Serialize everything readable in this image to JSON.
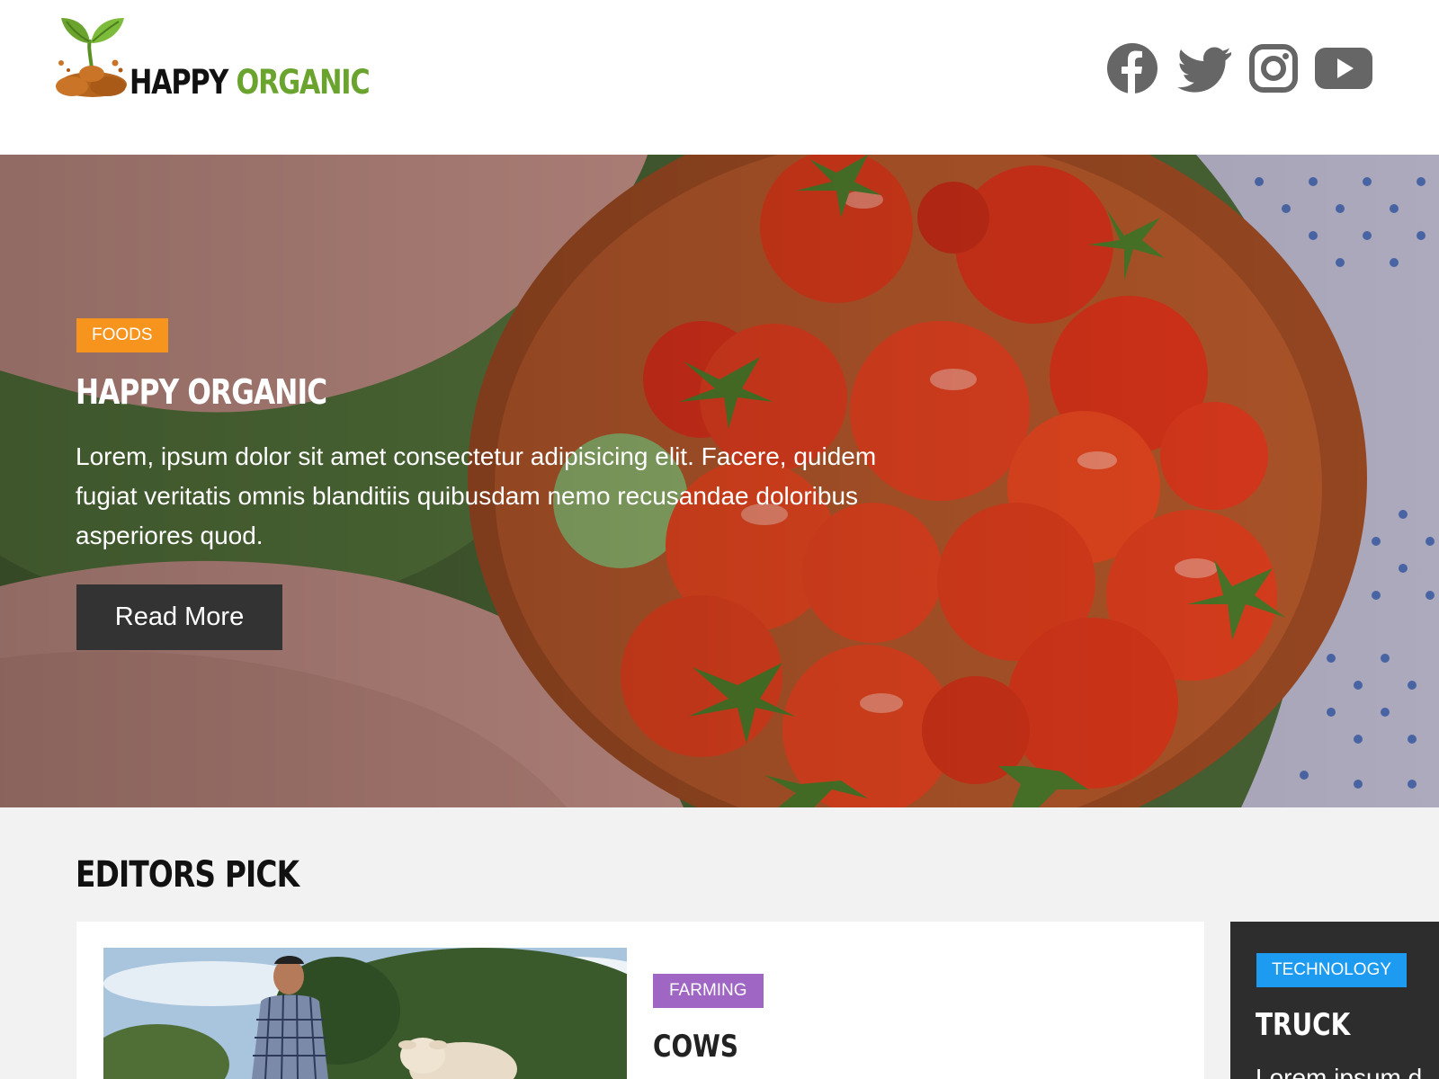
{
  "header": {
    "logo_word1": "HAPPY",
    "logo_word2": "ORGANIC",
    "social": [
      {
        "icon": "facebook-icon"
      },
      {
        "icon": "twitter-icon"
      },
      {
        "icon": "instagram-icon"
      },
      {
        "icon": "youtube-icon"
      }
    ]
  },
  "hero": {
    "category": "FOODS",
    "title": "HAPPY ORGANIC",
    "text": "Lorem, ipsum dolor sit amet consectetur adipisicing elit. Facere, quidem fugiat veritatis omnis blanditiis quibusdam nemo recusandae doloribus asperiores quod.",
    "button_label": "Read More"
  },
  "editors_pick": {
    "heading": "EDITORS PICK",
    "main_card": {
      "category": "FARMING",
      "title": "COWS"
    },
    "side_card": {
      "category": "TECHNOLOGY",
      "title": "TRUCK",
      "text_fragment": "Lorem ipsum d"
    }
  },
  "colors": {
    "brand_green": "#6aa42f",
    "foods_badge": "#f7941d",
    "farming_badge": "#a066c4",
    "technology_badge": "#1d9bf0",
    "button_dark": "#333333",
    "icon_gray": "#666666"
  }
}
